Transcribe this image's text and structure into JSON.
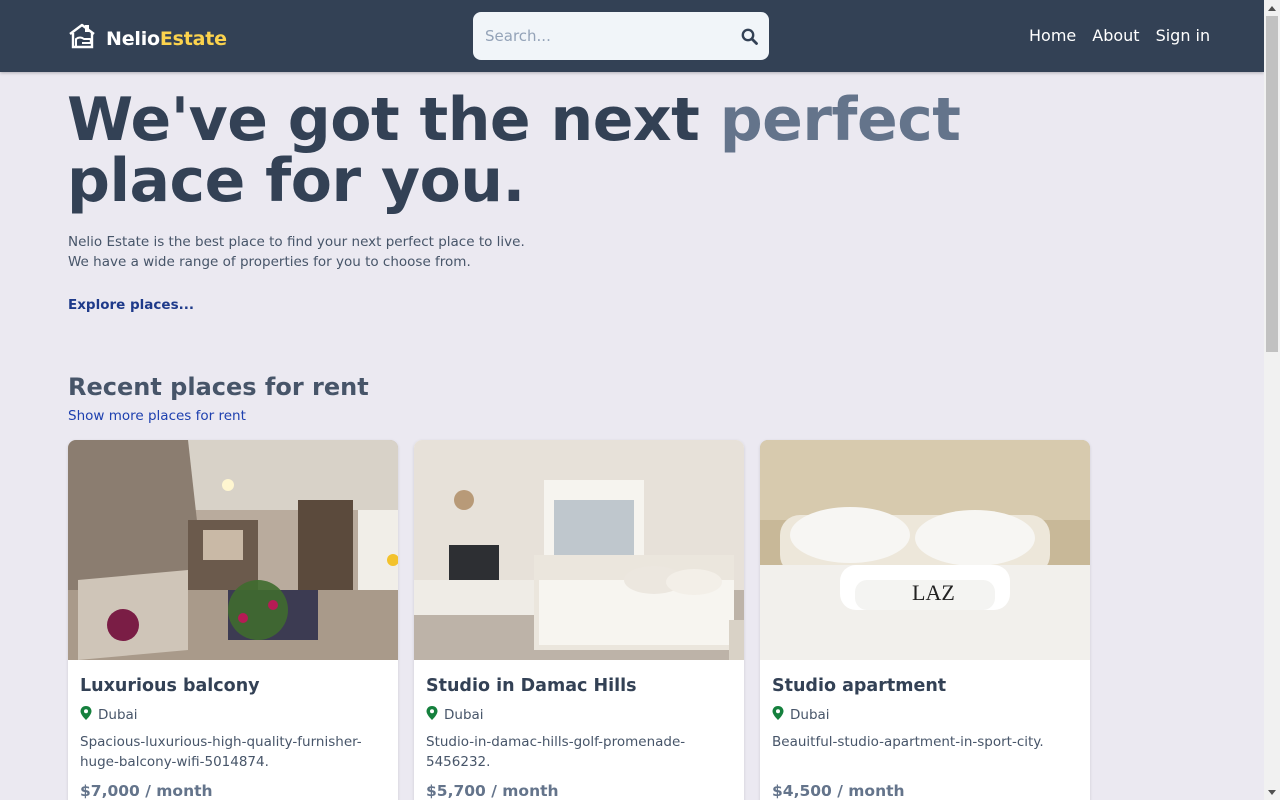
{
  "header": {
    "logo_part1": "Nelio",
    "logo_part2": "Estate",
    "logo_icon": "house-logo-icon",
    "search_placeholder": "Search...",
    "search_icon": "search-icon",
    "nav": [
      "Home",
      "About",
      "Sign in"
    ]
  },
  "hero": {
    "title_line1": "We've got the next ",
    "title_accent": "perfect",
    "title_line2": "place for you.",
    "desc_line1": "Nelio Estate is the best place to find your next perfect place to live.",
    "desc_line2": "We have a wide range of properties for you to choose from.",
    "explore_link": "Explore places..."
  },
  "section": {
    "title": "Recent places for rent",
    "show_more": "Show more places for rent"
  },
  "listings": [
    {
      "title": "Luxurious balcony",
      "location": "Dubai",
      "description": "Spacious-luxurious-high-quality-furnisher-huge-balcony-wifi-5014874.",
      "price": "$7,000 / month"
    },
    {
      "title": "Studio in Damac Hills",
      "location": "Dubai",
      "description": "Studio-in-damac-hills-golf-promenade-5456232.",
      "price": "$5,700 / month"
    },
    {
      "title": "Studio apartment",
      "location": "Dubai",
      "description": "Beauitful-studio-apartment-in-sport-city.",
      "price": "$4,500 / month"
    }
  ],
  "colors": {
    "header_bg": "#334155",
    "logo_accent": "#fcd34d",
    "page_bg": "#ebe9f1",
    "location_pin": "#15803d"
  }
}
